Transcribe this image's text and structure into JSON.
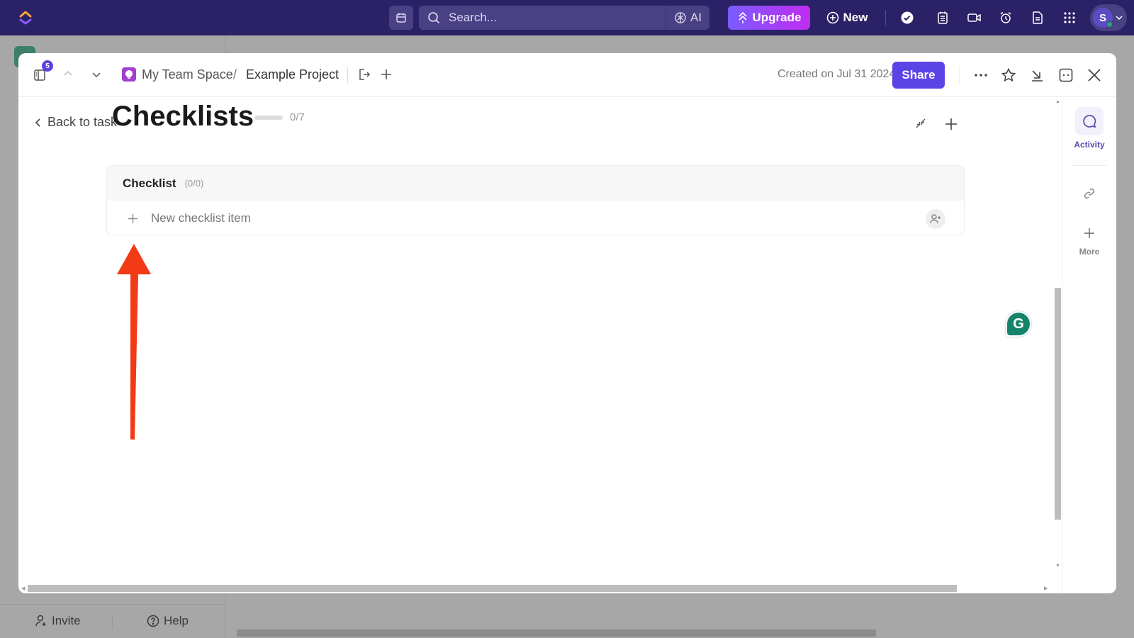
{
  "topbar": {
    "search_placeholder": "Search...",
    "ai_label": "AI",
    "upgrade_label": "Upgrade",
    "new_label": "New",
    "avatar_initial": "S",
    "colors": {
      "bar": "#2b2166",
      "upgrade_from": "#7b5cff",
      "upgrade_to": "#c02cf0"
    }
  },
  "modal": {
    "notification_count": "5",
    "breadcrumb": {
      "space": "My Team Space",
      "separator": "/",
      "project": "Example Project"
    },
    "created": "Created on Jul 31 2024",
    "share_label": "Share",
    "back_label": "Back to task",
    "title": "Checklists",
    "progress_text": "0/7",
    "progress_fraction": 0,
    "checklist": {
      "name": "Checklist",
      "count": "(0/0)",
      "new_item_placeholder": "New checklist item"
    },
    "rail": {
      "activity_label": "Activity",
      "more_label": "More"
    },
    "accent": "#5b43e6"
  },
  "background": {
    "invite_label": "Invite",
    "help_label": "Help"
  },
  "annotation": {
    "arrow_color": "#f23a16"
  }
}
